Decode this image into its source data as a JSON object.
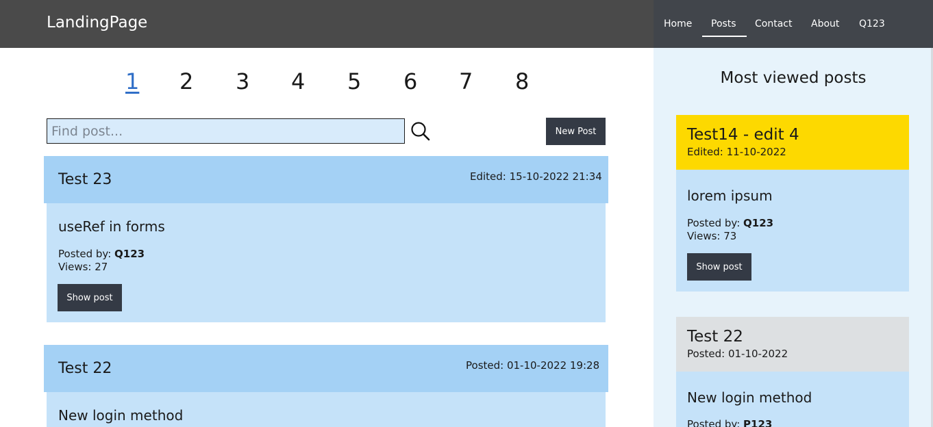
{
  "header": {
    "brand": "LandingPage",
    "nav": [
      "Home",
      "Posts",
      "Contact",
      "About",
      "Q123"
    ]
  },
  "pagination": {
    "pages": [
      "1",
      "2",
      "3",
      "4",
      "5",
      "6",
      "7",
      "8"
    ],
    "current": "1"
  },
  "search": {
    "placeholder": "Find post..."
  },
  "new_post_label": "New Post",
  "posts": [
    {
      "title": "Test 23",
      "date": "Edited: 15-10-2022 21:34",
      "subtitle": "useRef in forms",
      "posted_by_label": "Posted by: ",
      "author": "Q123",
      "views": "Views: 27",
      "button": "Show post"
    },
    {
      "title": "Test 22",
      "date": "Posted: 01-10-2022 19:28",
      "subtitle": "New login method"
    }
  ],
  "sidebar": {
    "title": "Most viewed posts",
    "cards": [
      {
        "title": "Test14 - edit 4",
        "date": "Edited: 11-10-2022",
        "subtitle": "lorem ipsum",
        "posted_by_label": "Posted by: ",
        "author": "Q123",
        "views": "Views: 73",
        "button": "Show post",
        "head_color": "#fdd900"
      },
      {
        "title": "Test 22",
        "date": "Posted: 01-10-2022",
        "subtitle": "New login method",
        "posted_by_label": "Posted by: ",
        "author": "P123",
        "head_color": "#dde0e2"
      }
    ]
  },
  "colors": {
    "navbar": "#4a4a4a",
    "accent": "#2f6ec7",
    "post_header": "#a4d1f5",
    "post_body": "#c5e2f9",
    "button": "#343a45"
  }
}
